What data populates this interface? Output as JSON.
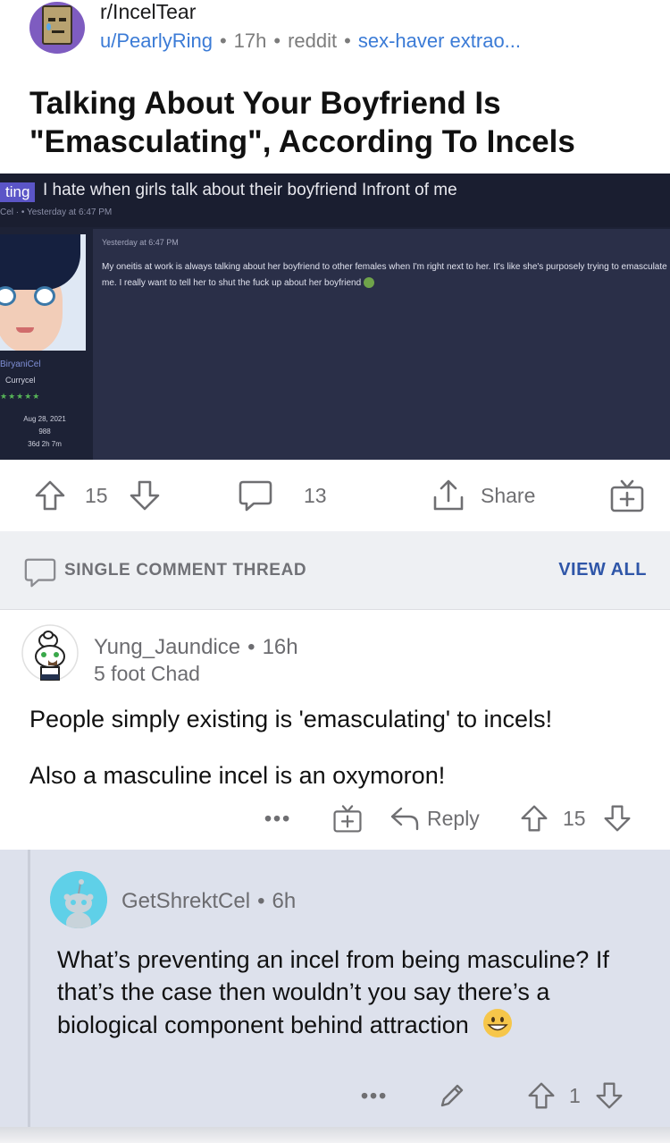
{
  "post": {
    "subreddit": "r/IncelTear",
    "username": "u/PearlyRing",
    "age": "17h",
    "source": "reddit",
    "flair": "sex-haver extrao...",
    "title": "Talking About Your Boyfriend Is \"Emasculating\", According To Incels"
  },
  "embed": {
    "tag": "ting",
    "heading": "I hate when girls talk about their boyfriend Infront of me",
    "subline": "Cel · • Yesterday at 6:47 PM",
    "time": "Yesterday at 6:47 PM",
    "body": "My oneitis at work is always talking about her boyfriend to other females when I'm right next to her. It's like she's purposely trying to emasculate me. I really want to tell her to shut the fuck up about her boyfriend",
    "author": "BiryaniCel",
    "rank": "Currycel",
    "stars": "★★★★★",
    "joined": "Aug 28, 2021",
    "posts": "988",
    "duration": "36d 2h 7m"
  },
  "actions": {
    "upvotes": "15",
    "comments": "13",
    "share_label": "Share"
  },
  "thread": {
    "label": "SINGLE COMMENT THREAD",
    "view_all": "VIEW ALL"
  },
  "comments": [
    {
      "user": "Yung_Jaundice",
      "age": "16h",
      "flair": "5 foot Chad",
      "paragraphs": [
        "People simply existing is 'emasculating' to incels!",
        "Also a masculine incel is an oxymoron!"
      ],
      "more": "•••",
      "reply_label": "Reply",
      "score": "15"
    },
    {
      "user": "GetShrektCel",
      "age": "6h",
      "text": "What’s preventing an incel from being masculine? If that’s the case then wouldn’t you say there’s a biological component behind attraction",
      "more": "•••",
      "score": "1"
    }
  ],
  "colors": {
    "link_blue": "#3b7bd6",
    "view_all_blue": "#2f56a8",
    "reply_bg": "#dde1ec",
    "thread_bar_bg": "#eef0f3",
    "embed_bg": "#1d2236"
  }
}
